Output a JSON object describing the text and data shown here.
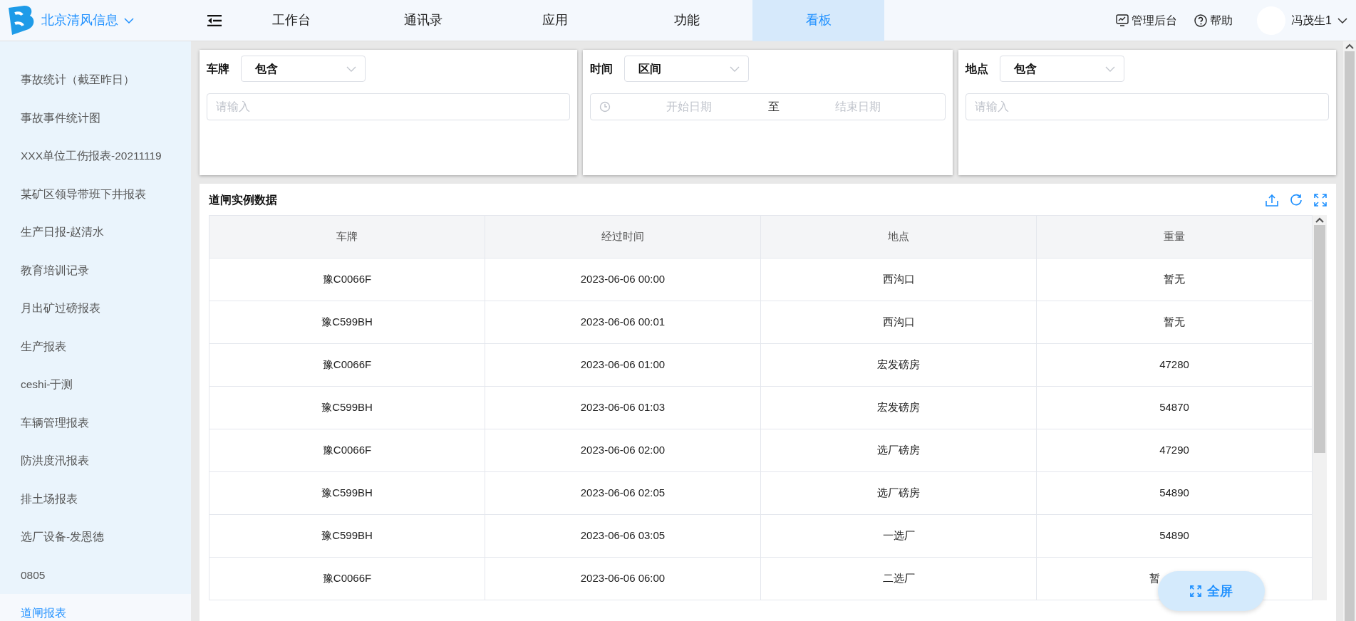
{
  "brand": {
    "name": "北京清风信息"
  },
  "nav": [
    {
      "label": "工作台",
      "selected": false
    },
    {
      "label": "通讯录",
      "selected": false
    },
    {
      "label": "应用",
      "selected": false
    },
    {
      "label": "功能",
      "selected": false
    },
    {
      "label": "看板",
      "selected": true
    }
  ],
  "header_actions": [
    {
      "kind": "admin",
      "label": "管理后台"
    },
    {
      "kind": "help",
      "label": "帮助"
    }
  ],
  "user": {
    "name": "冯茂生1"
  },
  "sidebar": {
    "items": [
      {
        "label": "事故统计（截至昨日）",
        "selected": false
      },
      {
        "label": "事故事件统计图",
        "selected": false
      },
      {
        "label": "XXX单位工伤报表-20211119",
        "selected": false
      },
      {
        "label": "某矿区领导带班下井报表",
        "selected": false
      },
      {
        "label": "生产日报-赵清水",
        "selected": false
      },
      {
        "label": "教育培训记录",
        "selected": false
      },
      {
        "label": "月出矿过磅报表",
        "selected": false
      },
      {
        "label": "生产报表",
        "selected": false
      },
      {
        "label": "ceshi-于测",
        "selected": false
      },
      {
        "label": "车辆管理报表",
        "selected": false
      },
      {
        "label": "防洪度汛报表",
        "selected": false
      },
      {
        "label": "排土场报表",
        "selected": false
      },
      {
        "label": "选厂设备-发恩德",
        "selected": false
      },
      {
        "label": "0805",
        "selected": false
      },
      {
        "label": "道闸报表",
        "selected": true
      }
    ]
  },
  "filters": [
    {
      "kind": "text",
      "label": "车牌",
      "mode": "包含",
      "placeholder": "请输入"
    },
    {
      "kind": "daterange",
      "label": "时间",
      "mode": "区间",
      "start_placeholder": "开始日期",
      "separator": "至",
      "end_placeholder": "结束日期"
    },
    {
      "kind": "text",
      "label": "地点",
      "mode": "包含",
      "placeholder": "请输入"
    }
  ],
  "table": {
    "title": "道闸实例数据",
    "columns": [
      "车牌",
      "经过时间",
      "地点",
      "重量"
    ],
    "rows": [
      [
        "豫C0066F",
        "2023-06-06 00:00",
        "西沟口",
        "暂无"
      ],
      [
        "豫C599BH",
        "2023-06-06 00:01",
        "西沟口",
        "暂无"
      ],
      [
        "豫C0066F",
        "2023-06-06 01:00",
        "宏发磅房",
        "47280"
      ],
      [
        "豫C599BH",
        "2023-06-06 01:03",
        "宏发磅房",
        "54870"
      ],
      [
        "豫C0066F",
        "2023-06-06 02:00",
        "选厂磅房",
        "47290"
      ],
      [
        "豫C599BH",
        "2023-06-06 02:05",
        "选厂磅房",
        "54890"
      ],
      [
        "豫C599BH",
        "2023-06-06 03:05",
        "一选厂",
        "54890"
      ],
      [
        "豫C0066F",
        "2023-06-06 06:00",
        "二选厂",
        "暂"
      ]
    ]
  },
  "fullscreen_button": {
    "label": "全屏"
  }
}
